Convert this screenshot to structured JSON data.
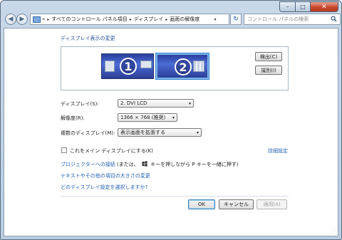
{
  "window": {
    "caption": {
      "minimize": "–",
      "maximize": "□",
      "close": "✕"
    }
  },
  "nav": {
    "back_glyph": "◀",
    "forward_glyph": "▶",
    "breadcrumb_prefix": "«",
    "breadcrumbs": [
      "すべてのコントロール パネル項目",
      "ディスプレイ",
      "画面の解像度"
    ],
    "breadcrumb_separator": "▸",
    "dropdown_glyph": "▾",
    "refresh_glyph": "↻",
    "search_placeholder": "コントロール パネルの検索"
  },
  "content": {
    "section_title": "ディスプレイ表示の変更",
    "monitors": [
      {
        "number": "1"
      },
      {
        "number": "2",
        "selected": true
      }
    ],
    "detect_button": "検出(C)",
    "identify_button": "識別(I)",
    "fields": {
      "display_label": "ディスプレイ(S):",
      "display_value": "2. DVI LCD",
      "resolution_label": "解像度(R):",
      "resolution_value": "1366 × 768 (推奨)",
      "multiple_label": "複数のディスプレイ(M):",
      "multiple_value": "表示画面を拡張する",
      "select_arrow": "▾"
    },
    "main_display_checkbox": {
      "label": "これをメイン ディスプレイにする(K)",
      "checked": false
    },
    "advanced_link": "詳細設定",
    "projector_link": "プロジェクターへの接続",
    "projector_hint": "(または、",
    "projector_hint2": "キーを押しながら P キーを一緒に押す)",
    "text_size_link": "テキストやその他の項目の大きさの変更",
    "which_settings_link": "どのディスプレイ設定を選択しますか?",
    "ok_button": "OK",
    "cancel_button": "キャンセル",
    "apply_button": "適用(A)",
    "apply_enabled": false
  },
  "colors": {
    "link": "#1f5fb3",
    "monitor_fill": "#3b56c2",
    "selected_border": "#7ab8ea",
    "close_button": "#c9462c"
  }
}
